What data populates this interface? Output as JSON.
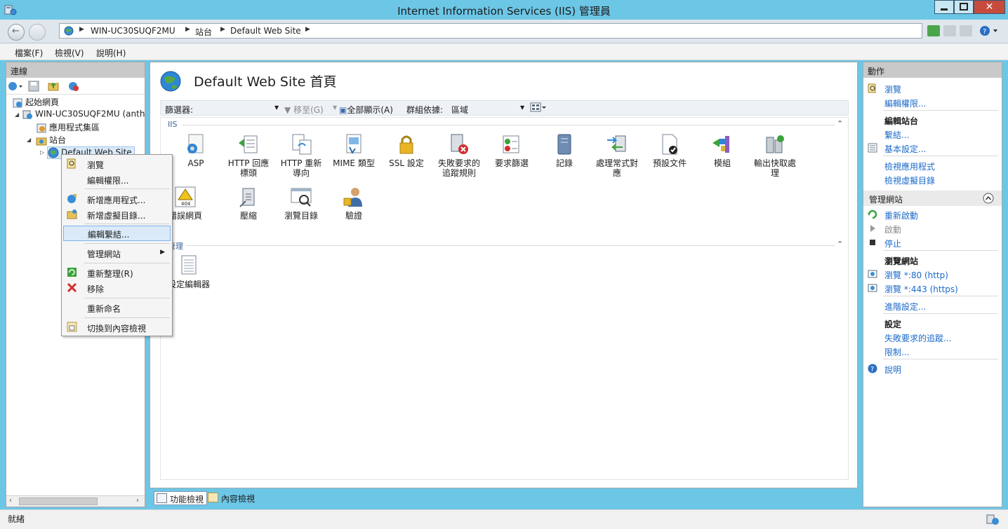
{
  "window": {
    "title": "Internet Information Services (IIS) 管理員"
  },
  "address": {
    "crumbs": [
      "WIN-UC30SUQF2MU",
      "站台",
      "Default Web Site"
    ]
  },
  "menu": [
    "檔案(F)",
    "檢視(V)",
    "說明(H)"
  ],
  "connections": {
    "header": "連線",
    "tree": {
      "start": "起始網頁",
      "server": "WIN-UC30SUQF2MU (anth",
      "app_pools": "應用程式集區",
      "sites": "站台",
      "site": "Default Web Site"
    }
  },
  "main": {
    "title": "Default Web Site 首頁",
    "filter": {
      "label": "篩選器:",
      "goto": "移至(G)",
      "show_all": "全部顯示(A)",
      "group_by": "群組依據:",
      "group_value": "區域"
    },
    "groups": [
      {
        "title": "IIS",
        "features": [
          "ASP",
          "HTTP 回應標頭",
          "HTTP 重新導向",
          "MIME 類型",
          "SSL 設定",
          "失敗要求的追蹤規則",
          "要求篩選",
          "記錄",
          "處理常式對應",
          "預設文件",
          "模組",
          "輸出快取處理",
          "錯誤網頁",
          "壓縮",
          "瀏覽目錄",
          "驗證"
        ]
      },
      {
        "title": "管理",
        "features": [
          "設定編輯器"
        ]
      }
    ],
    "views": {
      "features": "功能檢視",
      "content": "內容檢視"
    }
  },
  "actions": {
    "header": "動作",
    "browse": "瀏覽",
    "edit_permissions": "編輯權限...",
    "edit_site": "編輯站台",
    "bindings": "繫結...",
    "basic_settings": "基本設定...",
    "view_apps": "檢視應用程式",
    "view_vdirs": "檢視虛擬目錄",
    "manage_site": "管理網站",
    "restart": "重新啟動",
    "start": "啟動",
    "stop": "停止",
    "browse_site": "瀏覽網站",
    "browse_http": "瀏覽 *:80 (http)",
    "browse_https": "瀏覽 *:443 (https)",
    "advanced": "進階設定...",
    "settings": "設定",
    "failed_tracing": "失敗要求的追蹤...",
    "limits": "限制...",
    "help": "說明"
  },
  "context_menu": {
    "browse": "瀏覽",
    "edit_permissions": "編輯權限...",
    "add_app": "新增應用程式...",
    "add_vdir": "新增虛擬目錄...",
    "edit_bindings": "編輯繫結...",
    "manage_site": "管理網站",
    "refresh": "重新整理(R)",
    "remove": "移除",
    "rename": "重新命名",
    "switch_content": "切換到內容檢視"
  },
  "status": {
    "text": "就緒"
  },
  "colors": {
    "titlebar": "#6cc6e6",
    "link": "#1b6ac9",
    "close": "#c74b3d"
  }
}
